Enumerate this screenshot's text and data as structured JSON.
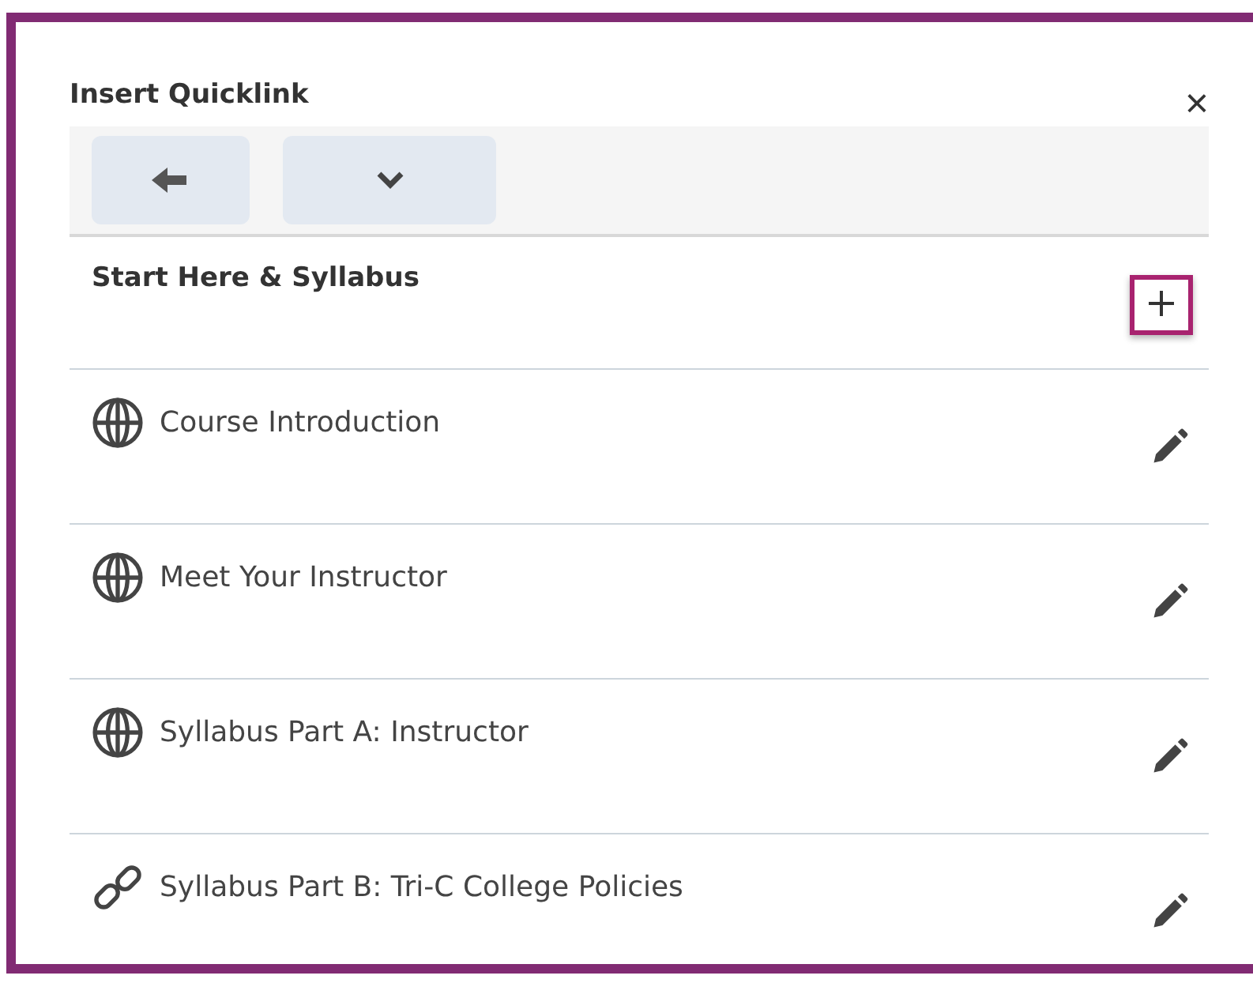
{
  "dialog": {
    "title": "Insert Quicklink",
    "close": "×"
  },
  "toolbar": {
    "buttons": [
      {
        "kind": "back"
      },
      {
        "kind": "dropdown"
      }
    ]
  },
  "section": {
    "title": "Start Here & Syllabus",
    "add_highlighted": true
  },
  "items": [
    {
      "kind": "globe",
      "label": "Course Introduction"
    },
    {
      "kind": "globe",
      "label": "Meet Your Instructor"
    },
    {
      "kind": "globe",
      "label": "Syllabus Part A: Instructor"
    },
    {
      "kind": "link",
      "label": "Syllabus Part B: Tri-C College Policies"
    }
  ]
}
